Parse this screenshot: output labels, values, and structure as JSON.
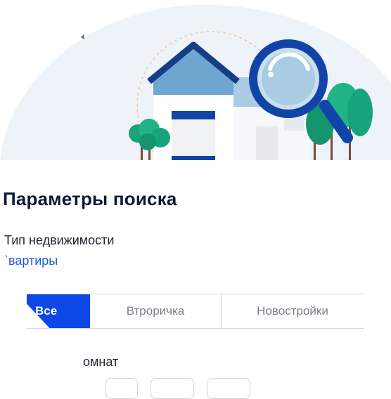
{
  "page": {
    "title": "Параметры поиска"
  },
  "property_type": {
    "label": "Тип недвижимости",
    "value": "ˋвартиры"
  },
  "market_filter": {
    "options": [
      "Все",
      "Втроричка",
      "Новостройки"
    ],
    "selected": "Все"
  },
  "rooms": {
    "label": "омнат"
  },
  "colors": {
    "accent": "#0d47e6",
    "link": "#1f5bd8",
    "title": "#0b1a3a"
  },
  "icons": [
    "house-illustration",
    "magnifier-icon",
    "tree-icon"
  ]
}
